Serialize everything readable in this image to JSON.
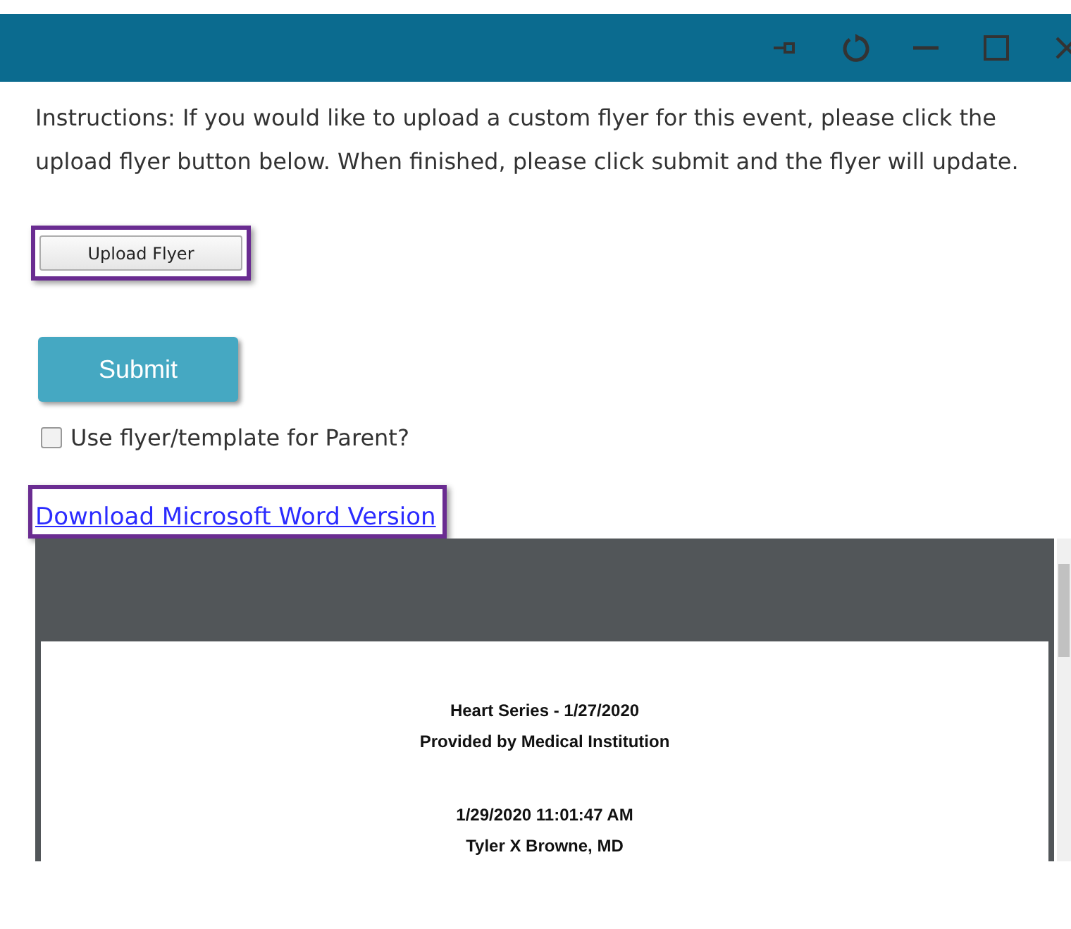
{
  "window": {
    "controls": [
      {
        "kind": "pin"
      },
      {
        "kind": "refresh"
      },
      {
        "kind": "minimize"
      },
      {
        "kind": "maximize"
      },
      {
        "kind": "close"
      }
    ]
  },
  "instructions": "Instructions: If you would like to upload a custom flyer for this event, please click the upload flyer button below. When finished, please click submit and the flyer will update.",
  "upload_button": {
    "label": "Upload Flyer",
    "highlighted": true
  },
  "submit_button": {
    "label": "Submit"
  },
  "parent_checkbox": {
    "label": "Use flyer/template for Parent?",
    "checked": false
  },
  "download_link": {
    "label": "Download Microsoft Word Version",
    "highlighted": true
  },
  "preview": {
    "groups": [
      [
        "Heart Series - 1/27/2020",
        "Provided by Medical Institution"
      ],
      [
        "1/29/2020 11:01:47 AM",
        "Tyler X Browne, MD"
      ]
    ]
  }
}
